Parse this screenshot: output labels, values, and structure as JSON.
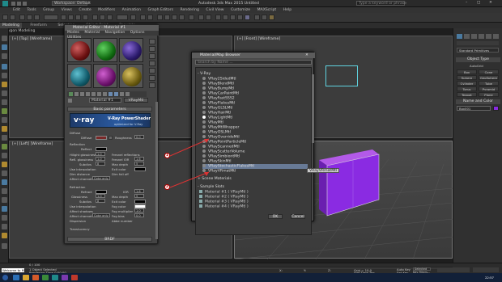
{
  "window": {
    "workspace": "Workspace: Default",
    "file_title": "Autodesk 3ds Max 2015   Untitled",
    "search_placeholder": "Type a keyword or phrase"
  },
  "menus": [
    "Edit",
    "Tools",
    "Group",
    "Views",
    "Create",
    "Modifiers",
    "Animation",
    "Graph Editors",
    "Rendering",
    "Civil View",
    "Customize",
    "MAXScript",
    "Help"
  ],
  "ribbon": {
    "tabs": [
      "Modeling",
      "Freeform",
      "Selection",
      "Object Paint",
      "Populate"
    ],
    "sub": "Polygon Modeling"
  },
  "viewports": {
    "top_left": "[+] [Top] [Wireframe]",
    "top_right": "[+] [Front] [Wireframe]",
    "bottom_left": "[+] [Left] [Wireframe]",
    "persp": "[+] [Perspective] [Realistic]"
  },
  "material_editor": {
    "title": "Material Editor - Material #1",
    "menus": [
      "Modes",
      "Material",
      "Navigation",
      "Options",
      "Utilities"
    ],
    "mat_name": "Material #1",
    "mat_type": "VRayMtl",
    "rollout_basic": "Basic parameters",
    "banner_logo": "v·ray",
    "banner_title": "V-Ray PowerShader",
    "banner_sub": "optimized for V-Ray",
    "diffuse_group": "Diffuse",
    "diffuse": "Diffuse",
    "roughness": "Roughness",
    "roughness_val": "0.0",
    "reflection_group": "Reflection",
    "reflect": "Reflect",
    "hilight_gloss": "Hilight glossiness",
    "refl_gloss": "Refl. glossiness",
    "subdivs": "Subdivs",
    "use_interp": "Use interpolation",
    "dim_dist": "Dim distance",
    "affect_channels": "Affect channels",
    "color_only": "Color only",
    "fresnel": "Fresnel reflections",
    "fresnel_ior": "Fresnel IOR",
    "max_depth": "Max depth",
    "exit_color": "Exit color",
    "dim_falloff": "Dim fall off",
    "refraction_group": "Refraction",
    "refract": "Refract",
    "ior": "IOR",
    "glossiness": "Glossiness",
    "abbe": "Abbe number",
    "affect_shadows": "Affect shadows",
    "fog_color": "Fog color",
    "fog_mult": "Fog multiplier",
    "fog_bias": "Fog bias",
    "dispersion": "Dispersion",
    "translucency": "Translucency",
    "v1": "1.0",
    "v8": "8",
    "v5": "5",
    "v16": "1.6",
    "v0": "0.0",
    "rollout_brdf": "BRDF"
  },
  "browser": {
    "title": "Material/Map Browser",
    "search_placeholder": "Search by Name ...",
    "group_vray": "- V-Ray",
    "items": [
      "VRay2SidedMtl",
      "VRayBlendMtl",
      "VRayBumpMtl",
      "VRayCarPaintMtl",
      "VRayFastSSS2",
      "VRayFlakesMtl",
      "VRayGLSLMtl",
      "VRayHairMtl",
      "VRayLightMtl",
      "VRayMtl",
      "VRayMtlWrapper",
      "VRayOSLMtl",
      "VRayOverrideMtl",
      "VRayPointParticleMtl",
      "VRayScannedMtl",
      "VRayScatterVolume",
      "VRaySimbiontMtl",
      "VRaySkinMtl",
      "VRayStochasticFlakesMtl",
      "VRayVRmatMtl"
    ],
    "selected_index": 18,
    "tooltip": "VRayVRmatMtl",
    "group_scene": "+ Scene Materials",
    "group_sample": "- Sample Slots",
    "sample_slots": [
      "Material #1 ( VRayMtl )",
      "Material #2 ( VRayMtl )",
      "Material #3 ( VRayMtl )",
      "Material #4 ( VRayMtl )"
    ],
    "ok": "OK",
    "cancel": "Cancel"
  },
  "callouts": [
    "1",
    "2"
  ],
  "command_panel": {
    "dropdown": "Standard Primitives",
    "rollout_type": "Object Type",
    "autogrid": "AutoGrid",
    "buttons": [
      "Box",
      "Cone",
      "Sphere",
      "GeoSphere",
      "Cylinder",
      "Tube",
      "Torus",
      "Pyramid",
      "Teapot",
      "Plane"
    ],
    "rollout_name": "Name and Color",
    "object_name": "Box001"
  },
  "status": {
    "frame": "0 / 100",
    "selected": "1 Object Selected",
    "hint": "Rendering Time 0:00:00",
    "welcome": "Welcome to M",
    "x": "X:",
    "y": "Y:",
    "z": "Z:",
    "grid": "Grid = 10.0",
    "autokey": "Auto Key",
    "selected_dd": "Selected",
    "setkey": "Set Key",
    "keyfilters": "Key Filters...",
    "addtimetag": "Add Time Tag",
    "time": "22:57"
  },
  "colors": {
    "box": "#8a2be2",
    "selection": "#687a96"
  }
}
